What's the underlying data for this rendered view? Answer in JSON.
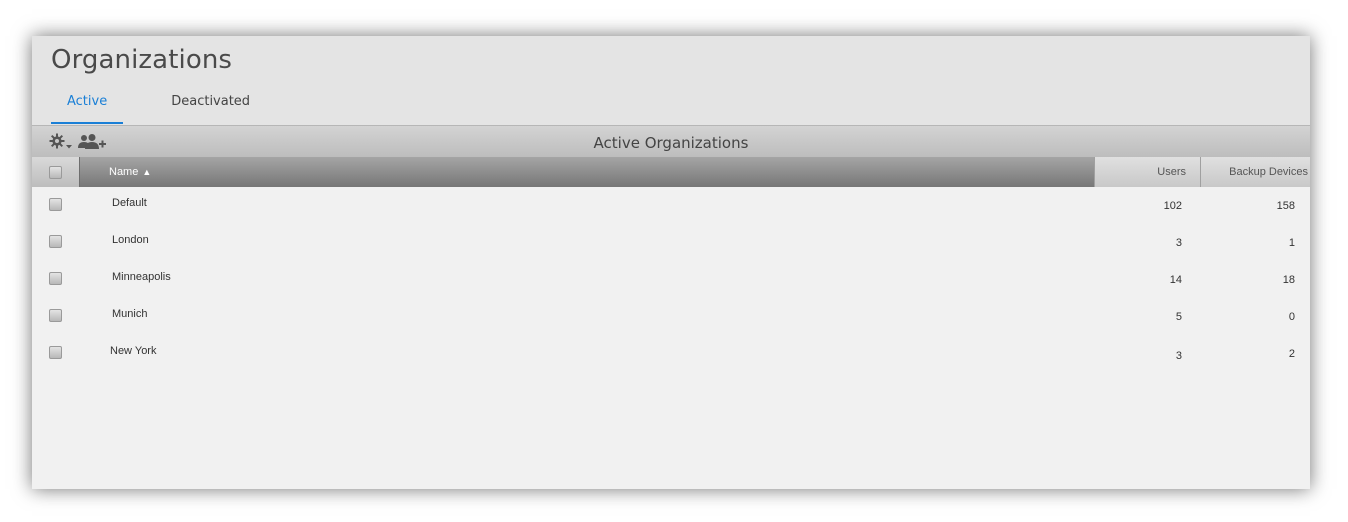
{
  "page": {
    "title": "Organizations",
    "tabs": [
      {
        "label": "Active",
        "active": true
      },
      {
        "label": "Deactivated",
        "active": false
      }
    ]
  },
  "toolbar": {
    "title": "Active Organizations",
    "icons": [
      "gear-menu-icon",
      "add-organization-icon"
    ]
  },
  "table": {
    "columns": {
      "name": "Name",
      "sort_indicator": "▲",
      "users": "Users",
      "backup_devices": "Backup Devices"
    },
    "rows": [
      {
        "name": "Default",
        "users": "102",
        "backup_devices": "158"
      },
      {
        "name": "London",
        "users": "3",
        "backup_devices": "1"
      },
      {
        "name": "Minneapolis",
        "users": "14",
        "backup_devices": "18"
      },
      {
        "name": "Munich",
        "users": "5",
        "backup_devices": "0"
      },
      {
        "name": "New York",
        "users": "3",
        "backup_devices": "2"
      }
    ]
  },
  "colors": {
    "accent": "#1a7fd6",
    "header_bg": "#e4e4e4",
    "table_bg": "#f1f1f1"
  }
}
